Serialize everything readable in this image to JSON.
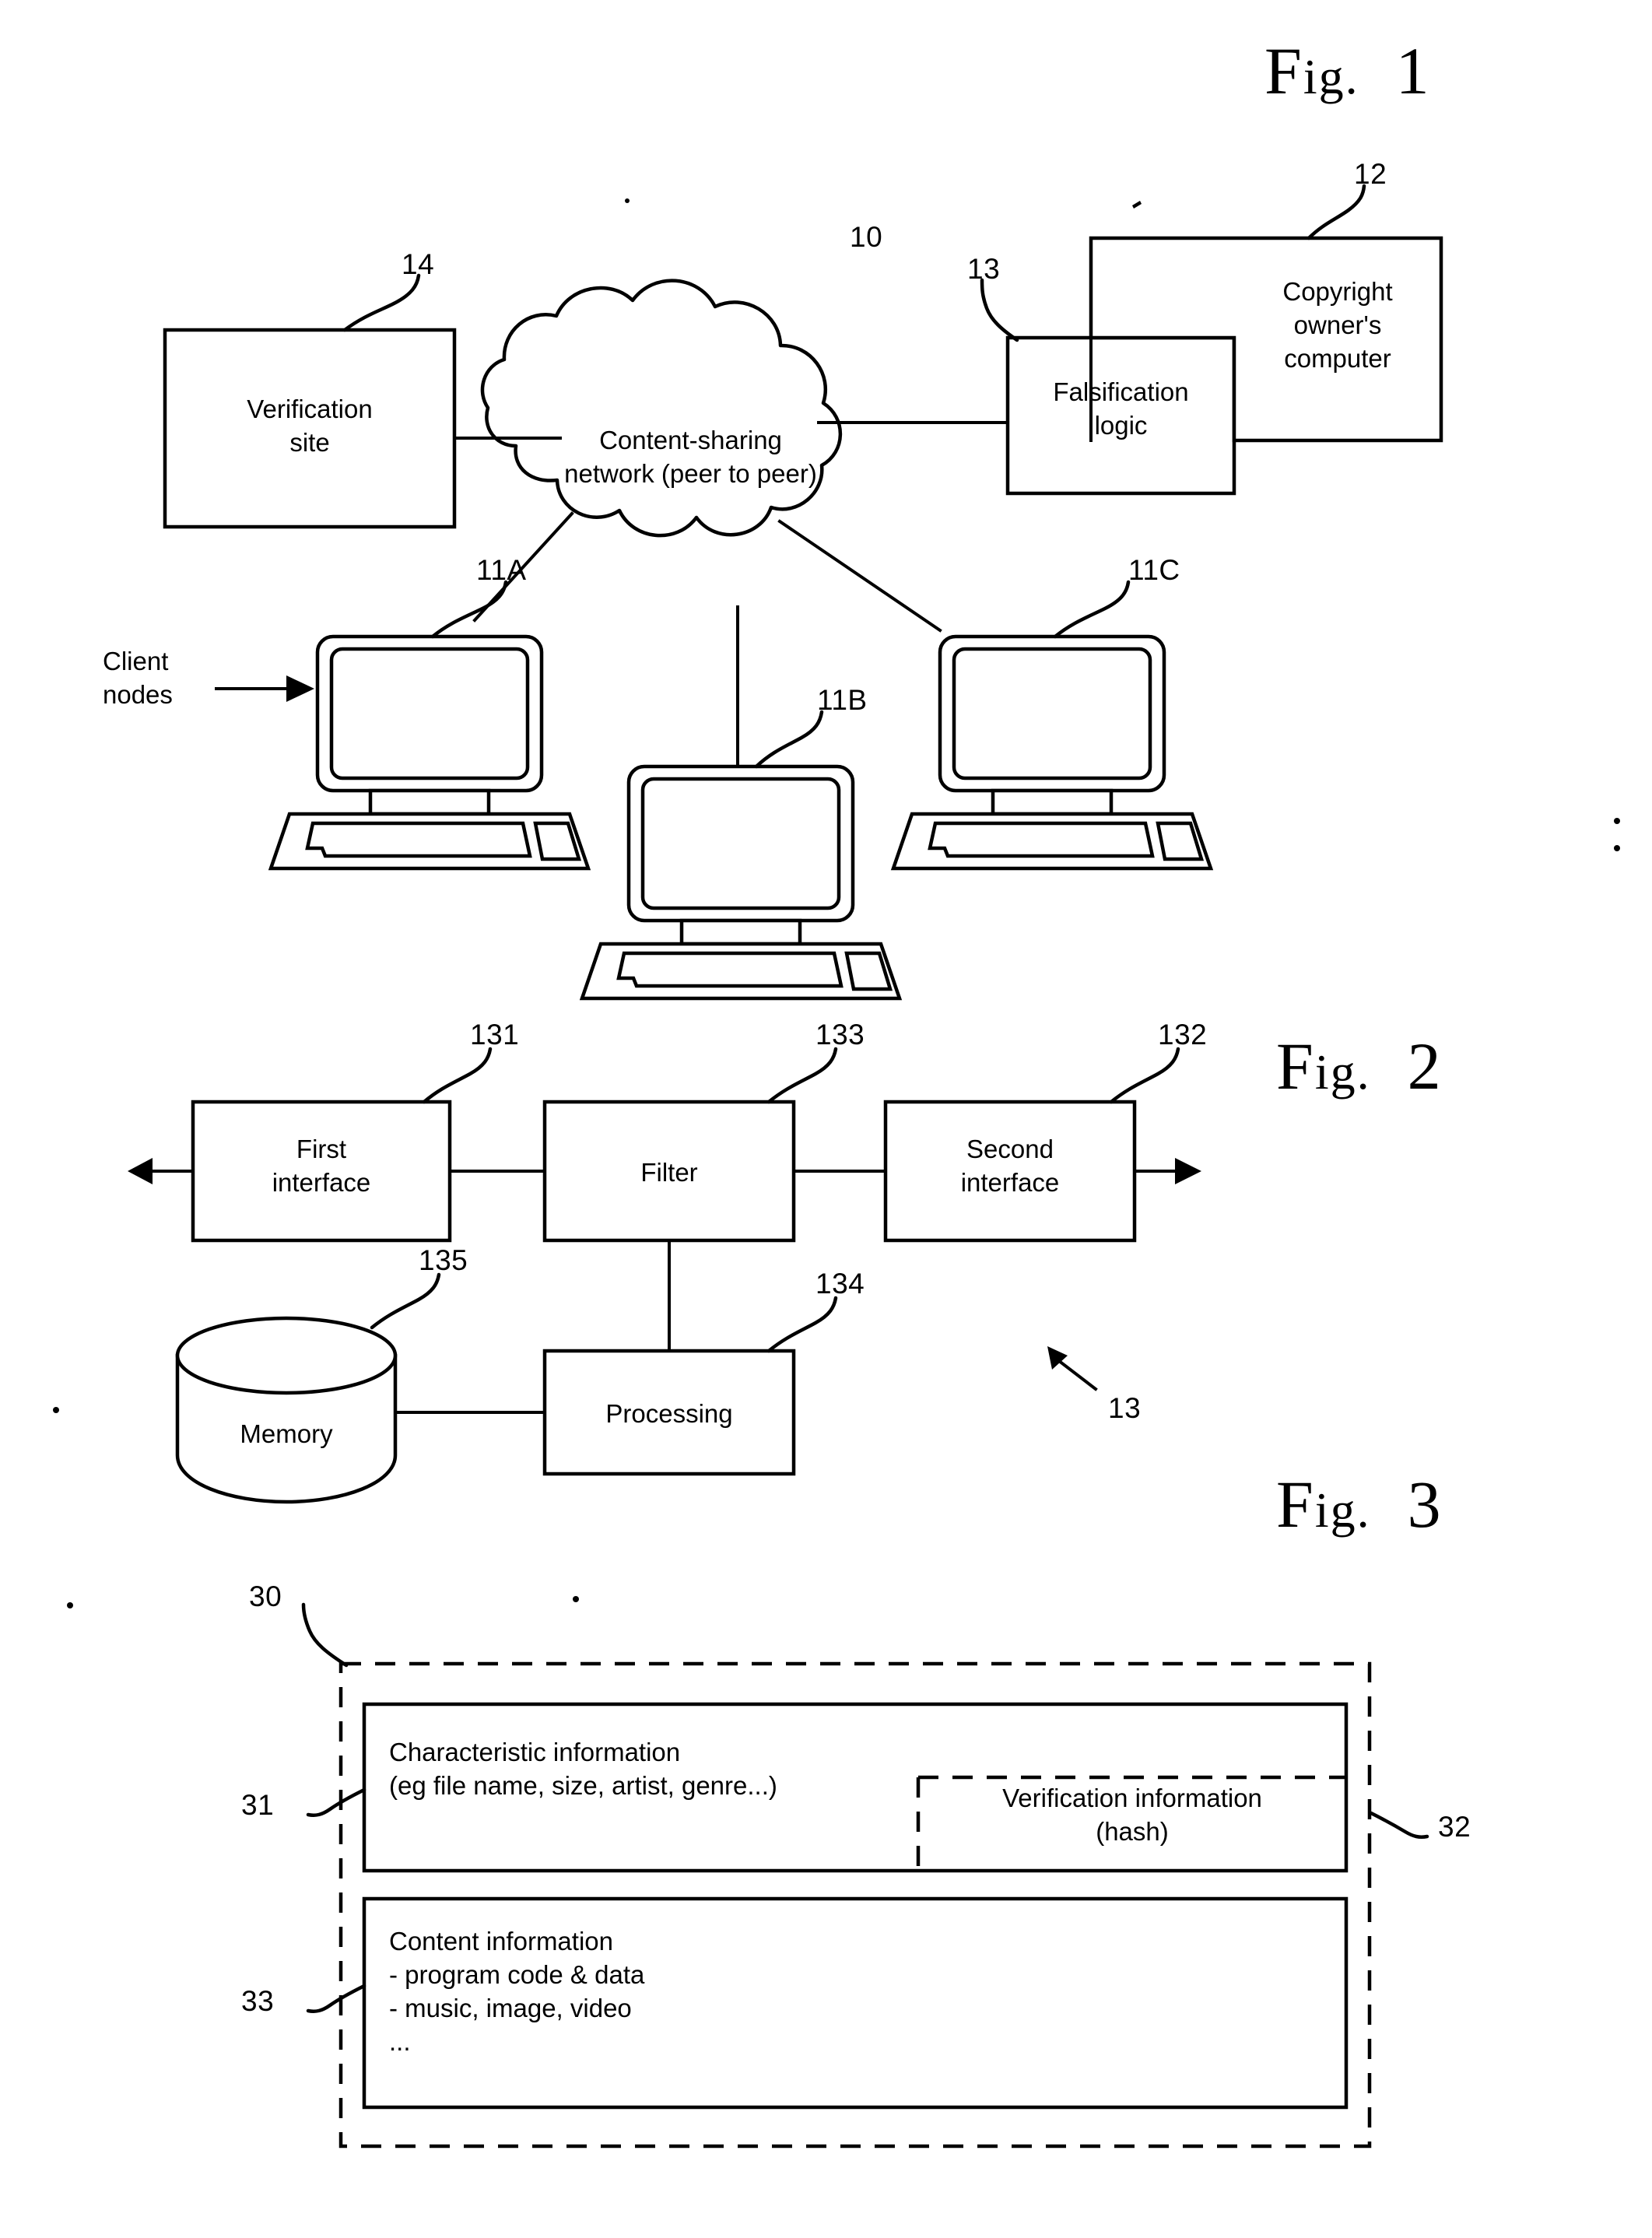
{
  "figures": [
    {
      "id": "fig1",
      "title_prefix": "F",
      "title_mid": "ig.",
      "title_num": "1",
      "nodes": {
        "verification_site": "Verification\nsite",
        "cloud": "Content-sharing\nnetwork (peer to peer)",
        "falsification_logic": "Falsification\nlogic",
        "copyright_owner": "Copyright\nowner's\ncomputer",
        "client_nodes_label": "Client\nnodes"
      },
      "refs": {
        "network": "10",
        "client_a": "11A",
        "client_b": "11B",
        "client_c": "11C",
        "copyright_computer": "12",
        "falsification": "13",
        "verification": "14"
      }
    },
    {
      "id": "fig2",
      "title_prefix": "F",
      "title_mid": "ig.",
      "title_num": "2",
      "nodes": {
        "first_interface": "First\ninterface",
        "filter": "Filter",
        "second_interface": "Second\ninterface",
        "memory": "Memory",
        "processing": "Processing"
      },
      "refs": {
        "first_interface": "131",
        "second_interface": "132",
        "filter": "133",
        "processing": "134",
        "memory": "135",
        "whole_unit": "13"
      }
    },
    {
      "id": "fig3",
      "title_prefix": "F",
      "title_mid": "ig.",
      "title_num": "3",
      "nodes": {
        "characteristic_information": "Characteristic information\n(eg file name, size, artist, genre...)",
        "verification_information": "Verification information\n(hash)",
        "content_information": "Content information\n- program code & data\n- music, image, video\n..."
      },
      "refs": {
        "file_record": "30",
        "characteristic": "31",
        "verification": "32",
        "content": "33"
      }
    }
  ]
}
